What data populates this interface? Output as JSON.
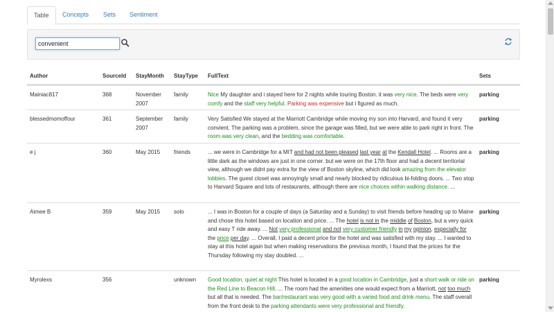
{
  "tabs": {
    "table": "Table",
    "concepts": "Concepts",
    "sets": "Sets",
    "sentiment": "Sentiment"
  },
  "search": {
    "value": "convenient",
    "icon": "search-icon",
    "refresh_icon": "refresh-icon"
  },
  "columns": {
    "author": "Author",
    "source_id": "SourceId",
    "stay_month": "StayMonth",
    "stay_type": "StayType",
    "full_text": "FullText",
    "sets": "Sets"
  },
  "rows": [
    {
      "author": "Mainiac817",
      "source_id": "368",
      "stay_month": "November 2007",
      "stay_type": "family",
      "sets": "parking",
      "text": [
        {
          "t": "Nice",
          "s": "pos"
        },
        {
          "t": " My daughter and i stayed here for 2 nights while touring Boston. it was ",
          "s": ""
        },
        {
          "t": "very nice",
          "s": "pos"
        },
        {
          "t": ". The beds were ",
          "s": ""
        },
        {
          "t": "very comfy",
          "s": "pos"
        },
        {
          "t": " and the ",
          "s": ""
        },
        {
          "t": "staff very helpful",
          "s": "pos"
        },
        {
          "t": ". ",
          "s": ""
        },
        {
          "t": "Parking was expensive",
          "s": "neg"
        },
        {
          "t": " but i figured as much.",
          "s": ""
        }
      ]
    },
    {
      "author": "blessedmomoffour",
      "source_id": "361",
      "stay_month": "September 2007",
      "stay_type": "family",
      "sets": "parking",
      "text": [
        {
          "t": "Very Satisfied We stayed at the Marriott Cambridge while moving my son into Harvard, and found it very convient. The parking was a problem, since the garage was filled, but we were able to park right in front. The ",
          "s": ""
        },
        {
          "t": "room was very clean",
          "s": "pos"
        },
        {
          "t": ", and the ",
          "s": ""
        },
        {
          "t": "bedding was comfortable",
          "s": "pos"
        },
        {
          "t": ".",
          "s": ""
        }
      ]
    },
    {
      "author": "e j",
      "source_id": "360",
      "stay_month": "May 2015",
      "stay_type": "friends",
      "sets": "parking",
      "text": [
        {
          "t": "... we were in Cambridge for a MIT ",
          "s": ""
        },
        {
          "t": "and had not been pleased",
          "s": "ul"
        },
        {
          "t": " ",
          "s": ""
        },
        {
          "t": "last year",
          "s": "ul"
        },
        {
          "t": " ",
          "s": ""
        },
        {
          "t": "at",
          "s": "ul"
        },
        {
          "t": " the ",
          "s": ""
        },
        {
          "t": "Kendall Hotel",
          "s": "ul"
        },
        {
          "t": ". ... Rooms are a little dark as the windows are just in one corner. but we were on the 17th floor and had a decent territorial view, although we didnt pay extra for the view of Boston skyline, which did look ",
          "s": ""
        },
        {
          "t": "amazing from the elevator lobbies",
          "s": "pos"
        },
        {
          "t": ". The guest closet was annoyingly small and nearly blocked by ridiculous bi-folding doors. ... Two stop to Harvard Square and lots of restaurants, although there are ",
          "s": ""
        },
        {
          "t": "nice choices within walking distance",
          "s": "pos"
        },
        {
          "t": ". ...",
          "s": ""
        }
      ]
    },
    {
      "author": "Aimee B",
      "source_id": "359",
      "stay_month": "May 2015",
      "stay_type": "solo",
      "sets": "parking",
      "text": [
        {
          "t": "... I was in Boston for a couple of days (a Saturday and a Sunday) to visit friends before heading up to Maine and chose this hotel based on location and price. ... The ",
          "s": ""
        },
        {
          "t": "hotel",
          "s": "ul"
        },
        {
          "t": " ",
          "s": ""
        },
        {
          "t": "is not in",
          "s": "ul"
        },
        {
          "t": " the ",
          "s": ""
        },
        {
          "t": "middle",
          "s": "ul"
        },
        {
          "t": " ",
          "s": ""
        },
        {
          "t": "of",
          "s": "ul"
        },
        {
          "t": " ",
          "s": ""
        },
        {
          "t": "Boston",
          "s": "ul"
        },
        {
          "t": ", but a very quick and easy T ride away. ... ",
          "s": ""
        },
        {
          "t": "Not",
          "s": "ul"
        },
        {
          "t": " ",
          "s": ""
        },
        {
          "t": "very professional",
          "s": "pos ul"
        },
        {
          "t": " ",
          "s": ""
        },
        {
          "t": "and not",
          "s": "ul"
        },
        {
          "t": " ",
          "s": ""
        },
        {
          "t": "very customer friendly",
          "s": "pos ul"
        },
        {
          "t": " ",
          "s": ""
        },
        {
          "t": "in",
          "s": "ul"
        },
        {
          "t": " ",
          "s": ""
        },
        {
          "t": "my",
          "s": "ul"
        },
        {
          "t": " ",
          "s": ""
        },
        {
          "t": "opinion",
          "s": "ul"
        },
        {
          "t": ", ",
          "s": ""
        },
        {
          "t": "especially for",
          "s": "ul"
        },
        {
          "t": " the ",
          "s": ""
        },
        {
          "t": "price",
          "s": "pos ul"
        },
        {
          "t": " ",
          "s": ""
        },
        {
          "t": "per day",
          "s": "ul"
        },
        {
          "t": ". ... Overall, I paid a decent price for the hotel and was satisfied with my stay. ... I wanted to stay at this hotel again but when making reservations the previous month, I found that the prices for the Thursday following my stay doubled. ...",
          "s": ""
        }
      ]
    },
    {
      "author": "Myrolexs",
      "source_id": "356",
      "stay_month": "",
      "stay_type": "unknown",
      "sets": "parking",
      "text": [
        {
          "t": "Good location, quiet at night",
          "s": "pos"
        },
        {
          "t": " This hotel is located in a ",
          "s": ""
        },
        {
          "t": "good location in Cambridge",
          "s": "pos"
        },
        {
          "t": ", just a ",
          "s": ""
        },
        {
          "t": "short walk or ride on the Red Line to Beacon Hill",
          "s": "pos"
        },
        {
          "t": ". ... The room had the amenities one would expect from a Marriott, ",
          "s": ""
        },
        {
          "t": "not",
          "s": "ul"
        },
        {
          "t": " ",
          "s": ""
        },
        {
          "t": "too much",
          "s": "ul"
        },
        {
          "t": " but all that is needed. The ",
          "s": ""
        },
        {
          "t": "bar/restaurant was very good with a varied food and drink menu",
          "s": "pos"
        },
        {
          "t": ". The staff overall from the front desk to the ",
          "s": ""
        },
        {
          "t": "parking attendants were very professional and friendly",
          "s": "pos"
        },
        {
          "t": ".",
          "s": ""
        }
      ]
    }
  ]
}
